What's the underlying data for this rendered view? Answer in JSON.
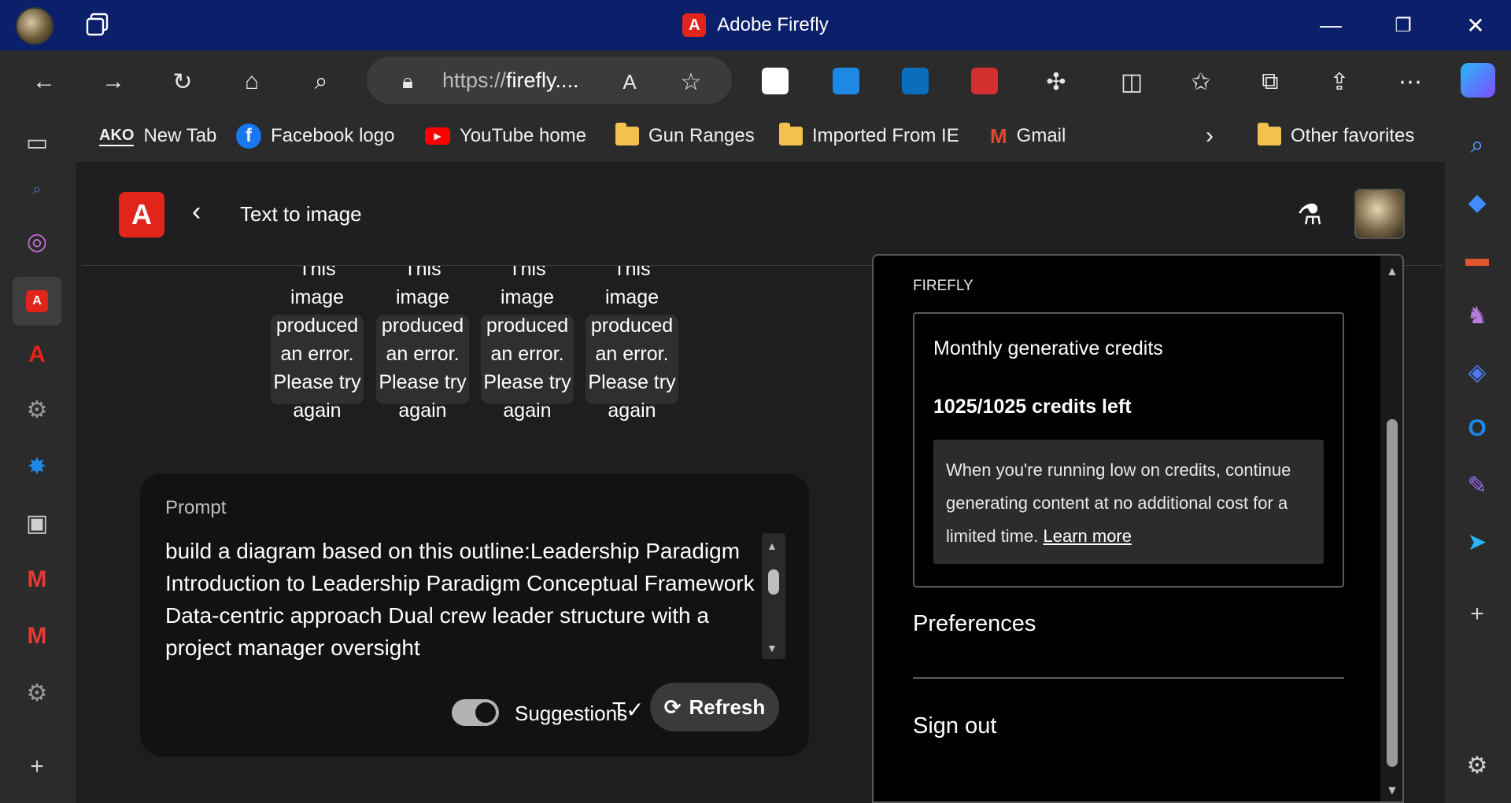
{
  "window": {
    "title": "Adobe Firefly",
    "minimize": "—",
    "restore": "❐",
    "close": "✕"
  },
  "browser": {
    "url_prefix": "https://",
    "url_host": "firefly....",
    "favorites": [
      {
        "label": "New Tab",
        "icon": "ako-icon"
      },
      {
        "label": "Facebook logo",
        "icon": "facebook-icon"
      },
      {
        "label": "YouTube home",
        "icon": "youtube-icon"
      },
      {
        "label": "Gun Ranges",
        "icon": "folder-icon"
      },
      {
        "label": "Imported From IE",
        "icon": "folder-icon"
      },
      {
        "label": "Gmail",
        "icon": "gmail-icon"
      }
    ],
    "other_favorites": "Other favorites",
    "ako_text": "AKO"
  },
  "app": {
    "header_title": "Text to image",
    "thumbnail_error": "This image produced an error. Please try again",
    "thumbnails_count": 4
  },
  "prompt": {
    "label": "Prompt",
    "text": "build a diagram based on this outline:Leadership Paradigm Introduction to Leadership Paradigm Conceptual Framework Data-centric approach Dual crew leader structure with a project manager oversight",
    "suggestions_label": "Suggestions",
    "suggestions_enabled": true,
    "refresh_label": "Refresh"
  },
  "account_menu": {
    "section": "FIREFLY",
    "credits_title": "Monthly generative credits",
    "credits_left": "1025/1025 credits left",
    "note": "When you're running low on credits, continue generating content at no additional cost for a limited time.",
    "learn_more": "Learn more",
    "preferences": "Preferences",
    "sign_out": "Sign out"
  },
  "colors": {
    "titlebar": "#0b1f6b",
    "adobe_red": "#e1251b",
    "chrome": "#2b2b2b"
  }
}
